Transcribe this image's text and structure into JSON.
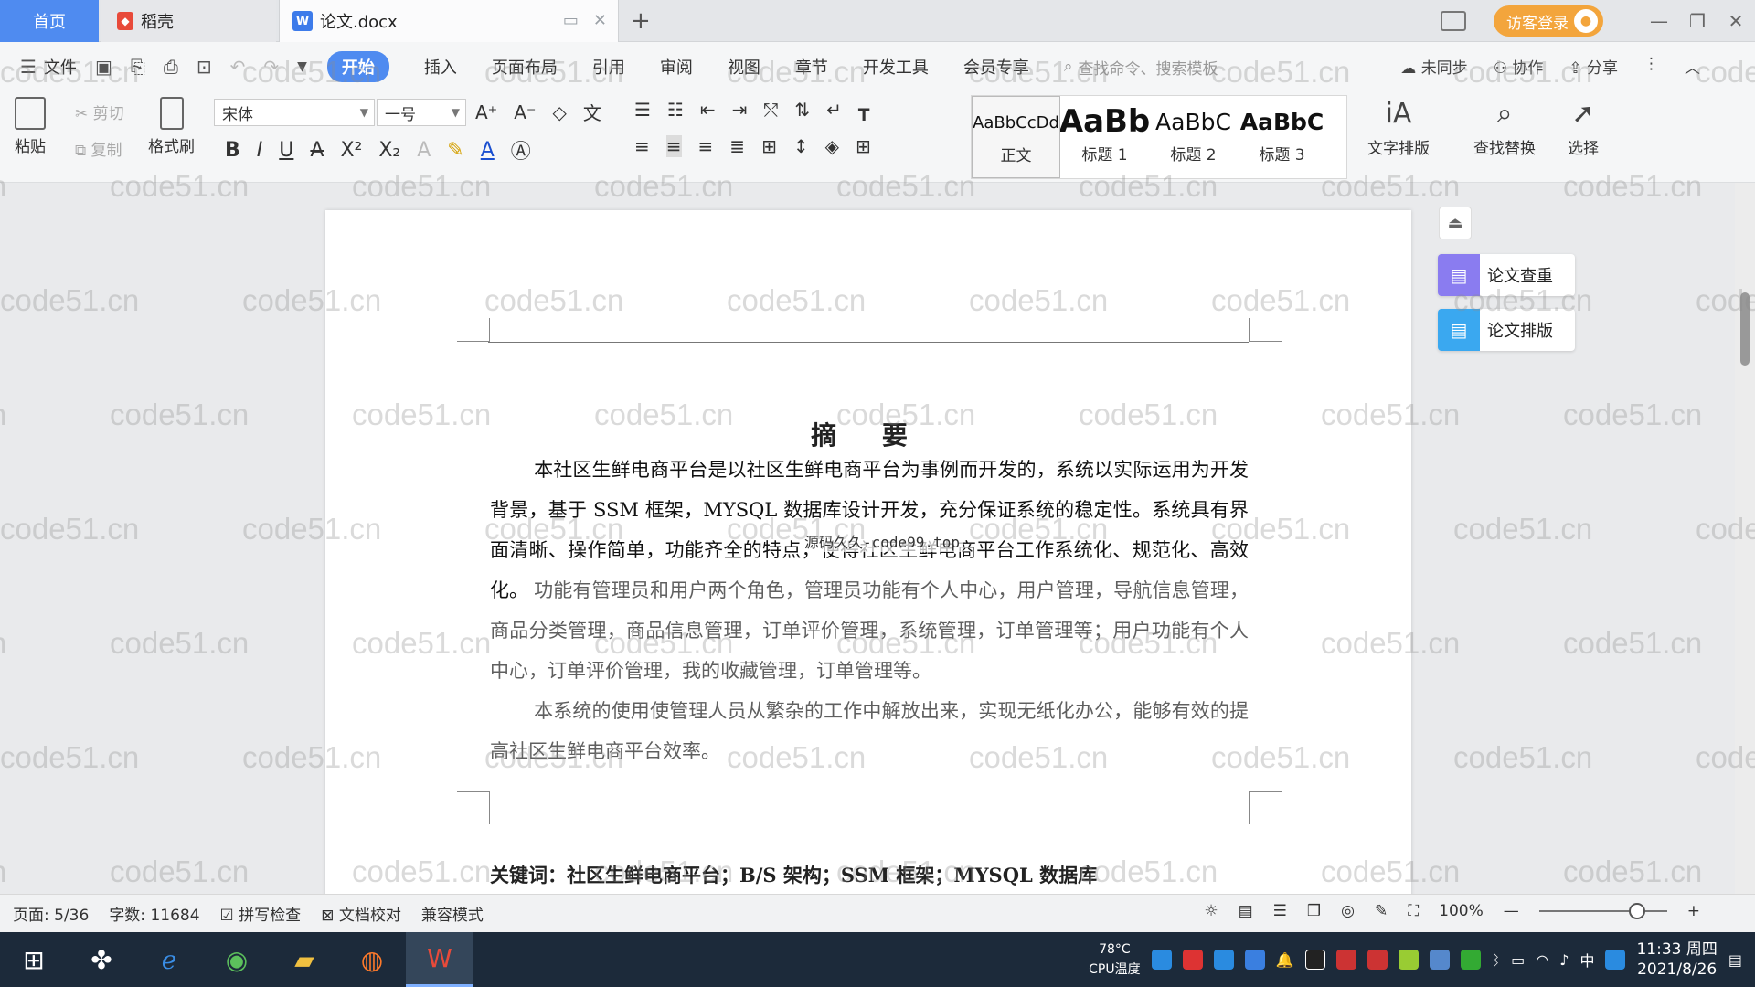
{
  "tabs": {
    "home": "首页",
    "daoke": "稻壳",
    "doc": "论文.docx",
    "visitor": "访客登录"
  },
  "menu": {
    "file": "文件",
    "items": [
      "开始",
      "插入",
      "页面布局",
      "引用",
      "审阅",
      "视图",
      "章节",
      "开发工具",
      "会员专享"
    ],
    "search_placeholder": "查找命令、搜索模板",
    "unsync": "未同步",
    "collab": "协作",
    "share": "分享"
  },
  "ribbon": {
    "paste": "粘贴",
    "cut": "剪切",
    "copy": "复制",
    "format_painter": "格式刷",
    "font_name": "宋体",
    "font_size": "一号",
    "styles": [
      {
        "preview": "AaBbCcDd",
        "name": "正文"
      },
      {
        "preview": "AaBb",
        "name": "标题 1"
      },
      {
        "preview": "AaBbC",
        "name": "标题 2"
      },
      {
        "preview": "AaBbC",
        "name": "标题 3"
      }
    ],
    "text_layout": "文字排版",
    "find_replace": "查找替换",
    "select": "选择"
  },
  "document": {
    "title": "摘 要",
    "para1": "本社区生鲜电商平台是以社区生鲜电商平台为事例而开发的，系统以实际运用为开发背景，基于 SSM 框架，MYSQL 数据库设计开发，充分保证系统的稳定性。系统具有界面清晰、操作简单，功能齐全的特点，使得社区生鲜电商平台工作系统化、规范化、高效化。",
    "para2": "功能有管理员和用户两个角色，管理员功能有个人中心，用户管理，导航信息管理，商品分类管理，商品信息管理，订单评价管理，系统管理，订单管理等；用户功能有个人中心，订单评价管理，我的收藏管理，订单管理等。",
    "para3": "本系统的使用使管理人员从繁杂的工作中解放出来，实现无纸化办公，能够有效的提高社区生鲜电商平台效率。",
    "keywords": "关键词：社区生鲜电商平台；B/S 架构；SSM 框架；MYSQL 数据库",
    "overlay": "源码久久-code99.top",
    "watermark": "code51.cn"
  },
  "side_panel": {
    "check": "论文查重",
    "layout": "论文排版"
  },
  "status": {
    "page": "页面: 5/36",
    "words": "字数: 11684",
    "spell": "拼写检查",
    "proof": "文档校对",
    "compat": "兼容模式",
    "zoom": "100%"
  },
  "taskbar": {
    "temp": "78°C",
    "cpu": "CPU温度",
    "ime": "中",
    "time": "11:33 周四",
    "date": "2021/8/26"
  },
  "colors": {
    "accent": "#4f8bf0",
    "visitor": "#f3a53c",
    "check_icon": "#8a7cf0",
    "layout_icon": "#3aa8f0"
  }
}
